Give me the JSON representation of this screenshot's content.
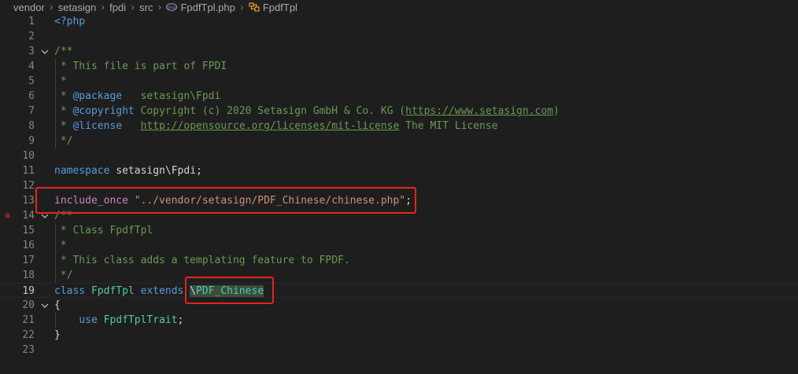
{
  "breadcrumb": {
    "items": [
      "vendor",
      "setasign",
      "fpdi",
      "src",
      "FpdfTpl.php",
      "FpdfTpl"
    ],
    "file_icon": "php-file-icon",
    "symbol_icon": "class-symbol-icon"
  },
  "editor": {
    "line_numbers": [
      "1",
      "2",
      "3",
      "4",
      "5",
      "6",
      "7",
      "8",
      "9",
      "10",
      "11",
      "12",
      "13",
      "14",
      "15",
      "16",
      "17",
      "18",
      "19",
      "20",
      "21",
      "22",
      "23"
    ],
    "active_line": "19",
    "breakpoint_line": "14",
    "lines": {
      "l1": {
        "open_tag": "<?php"
      },
      "l3": {
        "text": "/**"
      },
      "l4": {
        "text": " * This file is part of FPDI"
      },
      "l5": {
        "text": " *"
      },
      "l6": {
        "star": " * ",
        "tag": "@package",
        "rest": "   setasign\\Fpdi"
      },
      "l7": {
        "star": " * ",
        "tag": "@copyright",
        "rest": " Copyright (c) 2020 Setasign GmbH & Co. KG (",
        "url": "https://www.setasign.com",
        "end": ")"
      },
      "l8": {
        "star": " * ",
        "tag": "@license",
        "gap": "   ",
        "url": "http://opensource.org/licenses/mit-license",
        "rest": " The MIT License"
      },
      "l9": {
        "text": " */"
      },
      "l11": {
        "keyword": "namespace",
        "name": " setasign\\Fpdi",
        "end": ";"
      },
      "l13": {
        "keyword": "include_once",
        "space": " ",
        "string": "\"../vendor/setasign/PDF_Chinese/chinese.php\"",
        "end": ";"
      },
      "l14": {
        "text": "/**"
      },
      "l15": {
        "text": " * Class FpdfTpl"
      },
      "l16": {
        "text": " *"
      },
      "l17": {
        "text": " * This class adds a templating feature to FPDF."
      },
      "l18": {
        "text": " */"
      },
      "l19": {
        "kw_class": "class",
        "name": " FpdfTpl ",
        "kw_extends": "extends",
        "space": " ",
        "slash": "\\",
        "parent": "PDF_Chinese"
      },
      "l20": {
        "text": "{"
      },
      "l21": {
        "indent": "    ",
        "keyword": "use",
        "name": " FpdfTplTrait",
        "end": ";"
      },
      "l22": {
        "text": "}"
      }
    }
  },
  "colors": {
    "background": "#1e1e1e",
    "comment": "#6a9955",
    "keyword": "#569cd6",
    "type": "#4ec9b0",
    "string": "#ce9178",
    "highlight_box": "#e8241c"
  }
}
